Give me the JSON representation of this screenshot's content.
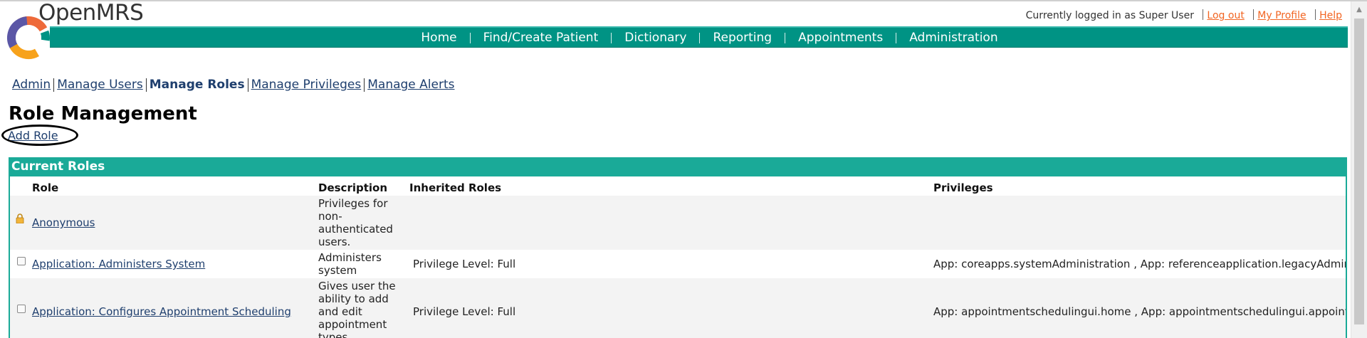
{
  "app": {
    "logo_text": "OpenMRS"
  },
  "userbar": {
    "logged_in_text": "Currently logged in as Super User",
    "links": [
      "Log out",
      "My Profile",
      "Help"
    ]
  },
  "nav": {
    "items": [
      "Home",
      "Find/Create Patient",
      "Dictionary",
      "Reporting",
      "Appointments",
      "Administration"
    ]
  },
  "submenu": {
    "admin": "Admin",
    "manage_users": "Manage Users",
    "manage_roles": "Manage Roles",
    "manage_privileges": "Manage Privileges",
    "manage_alerts": "Manage Alerts"
  },
  "page": {
    "title": "Role Management",
    "add_role": "Add Role"
  },
  "roles_table": {
    "header": "Current Roles",
    "columns": [
      "Role",
      "Description",
      "Inherited Roles",
      "Privileges"
    ],
    "rows": [
      {
        "role": "Anonymous",
        "description": "Privileges for non-authenticated users.",
        "inherited": "",
        "privileges": "",
        "locked": true,
        "icon": "lock-icon"
      },
      {
        "role": "Application: Administers System",
        "description": "Administers system",
        "inherited": "Privilege Level: Full",
        "privileges": "App: coreapps.systemAdministration , App: referenceapplication.legacyAdmin",
        "locked": false
      },
      {
        "role": "Application: Configures Appointment Scheduling",
        "description": "Gives user the ability to add and edit appointment types",
        "inherited": "Privilege Level: Full",
        "privileges": "App: appointmentschedulingui.home , App: appointmentschedulingui.appointmentTypes",
        "locked": false
      }
    ]
  },
  "colors": {
    "nav_bg": "#009384",
    "header_bg": "#1aaa98",
    "link": "#1f3f6e",
    "userbar_link": "#f26522",
    "logo_orange": "#f7a21b",
    "logo_purple": "#5b57a6",
    "logo_red": "#ee6a3a"
  }
}
